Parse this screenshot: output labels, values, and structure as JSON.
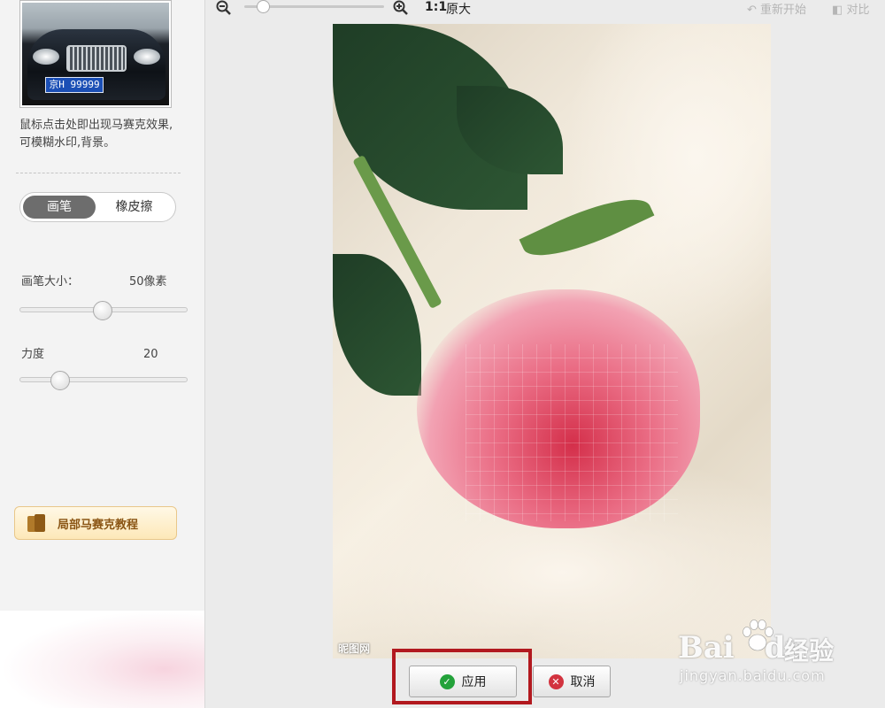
{
  "sidebar": {
    "thumbnail": {
      "plate_text": "京H 99999"
    },
    "hint_text": "鼠标点击处即出现马赛克效果,可模糊水印,背景。",
    "mode_toggle": {
      "brush_label": "画笔",
      "eraser_label": "橡皮擦",
      "selected": "画笔"
    },
    "brush_size": {
      "label": "画笔大小：",
      "value_text": "50像素",
      "slider_fraction": 0.49
    },
    "strength": {
      "label": "力度",
      "value_text": "20",
      "slider_fraction": 0.2
    },
    "tutorial_button_label": "局部马赛克教程"
  },
  "toolbar": {
    "zoom_out_icon": "zoom-out-icon",
    "zoom_in_icon": "zoom-in-icon",
    "zoom_fraction": 0.1,
    "one_to_one_label": "1:1",
    "original_size_label": "原大",
    "reset_label": "重新开始",
    "compare_label": "对比"
  },
  "canvas": {
    "image_watermark": "昵图网"
  },
  "actions": {
    "apply_label": "应用",
    "cancel_label": "取消"
  },
  "watermark": {
    "brand": "Bai",
    "brand_suffix": "du",
    "product": "经验",
    "url": "jingyan.baidu.com"
  },
  "colors": {
    "highlight": "#b2191f",
    "apply_icon": "#23a23a",
    "cancel_icon": "#d2333f"
  }
}
